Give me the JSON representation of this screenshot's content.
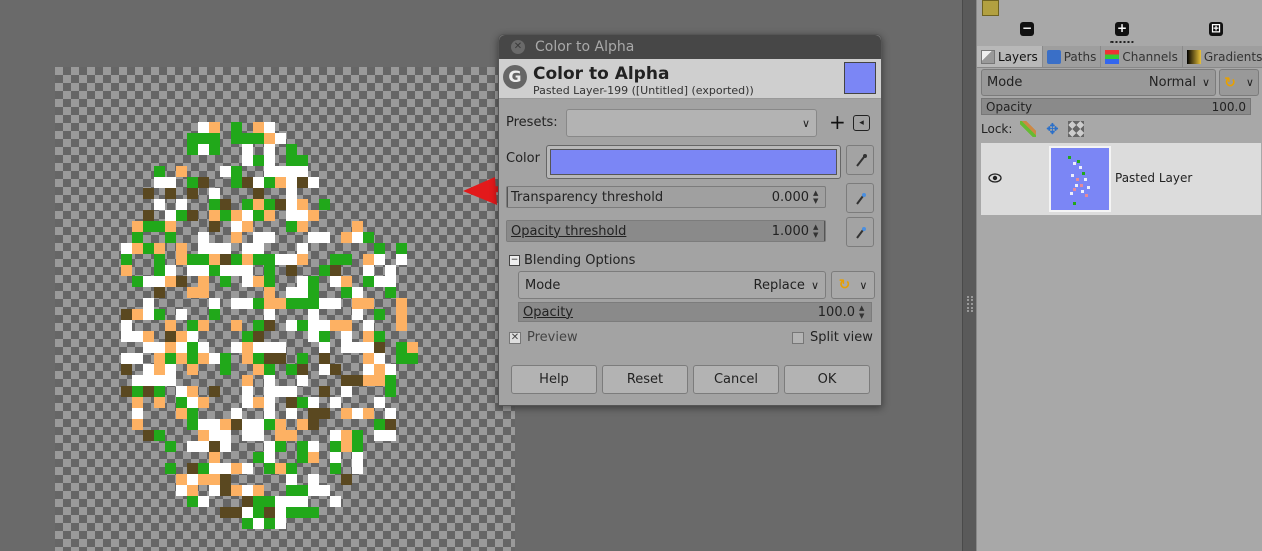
{
  "dialog": {
    "window_title": "Color to Alpha",
    "heading": "Color to Alpha",
    "subheading": "Pasted Layer-199 ([Untitled] (exported))",
    "presets_label": "Presets:",
    "color_label": "Color",
    "color_value": "#7b86f5",
    "transparency_threshold": {
      "label": "Transparency threshold",
      "value": "0.000",
      "fraction": 0.0
    },
    "opacity_threshold": {
      "label": "Opacity threshold",
      "value": "1.000",
      "fraction": 1.0
    },
    "blending_options_label": "Blending Options",
    "mode_label": "Mode",
    "mode_value": "Replace",
    "opacity_label": "Opacity",
    "opacity_value": "100.0",
    "preview_label": "Preview",
    "preview_checked": true,
    "split_view_label": "Split view",
    "split_view_checked": false,
    "buttons": {
      "help": "Help",
      "reset": "Reset",
      "cancel": "Cancel",
      "ok": "OK"
    }
  },
  "dock": {
    "tabs": [
      {
        "label": "Layers",
        "icon": "layers-icon"
      },
      {
        "label": "Paths",
        "icon": "paths-icon"
      },
      {
        "label": "Channels",
        "icon": "channels-icon"
      },
      {
        "label": "Gradients",
        "icon": "gradients-icon"
      }
    ],
    "mode_label": "Mode",
    "mode_value": "Normal",
    "opacity_label": "Opacity",
    "opacity_value": "100.0",
    "lock_label": "Lock:",
    "layers": [
      {
        "name": "Pasted Layer",
        "visible": true
      }
    ]
  },
  "colors": {
    "pixel_green": "#21a81a",
    "pixel_orange": "#fdb163",
    "pixel_white": "#ffffff",
    "pixel_brown": "#5a4820",
    "arrow_red": "#e3191b",
    "layer_fill": "#7b86f5"
  }
}
